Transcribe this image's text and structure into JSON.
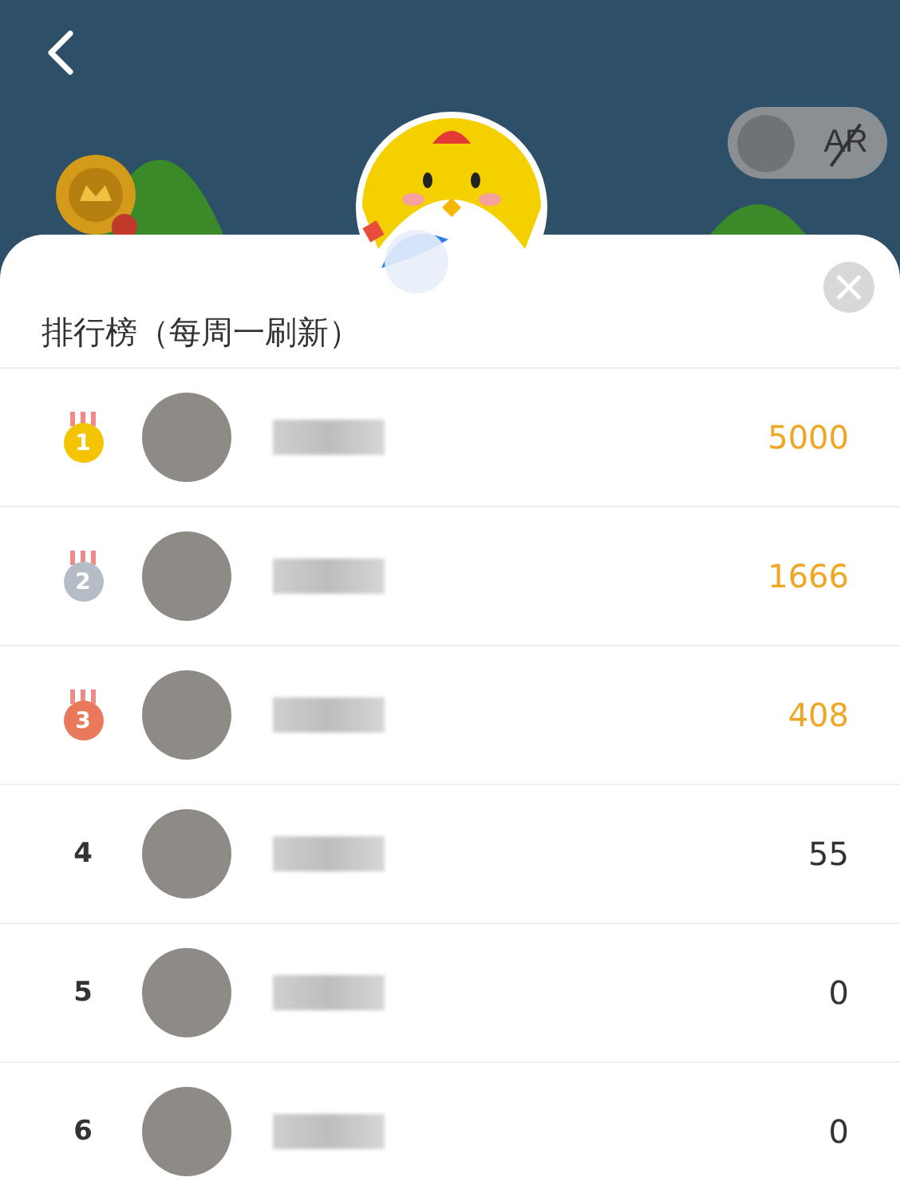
{
  "ar_toggle": {
    "label": "AR",
    "on": false
  },
  "leaderboard": {
    "title": "排行榜（每周一刷新）",
    "rows": [
      {
        "kind": "medal",
        "rank": "1",
        "color": "#f5c400",
        "score": "5000"
      },
      {
        "kind": "medal",
        "rank": "2",
        "color": "#b4bcc6",
        "score": "1666"
      },
      {
        "kind": "medal",
        "rank": "3",
        "color": "#e8795a",
        "score": "408"
      },
      {
        "kind": "plain",
        "rank": "4",
        "score": "55"
      },
      {
        "kind": "plain",
        "rank": "5",
        "score": "0"
      },
      {
        "kind": "plain",
        "rank": "6",
        "score": "0"
      }
    ]
  }
}
